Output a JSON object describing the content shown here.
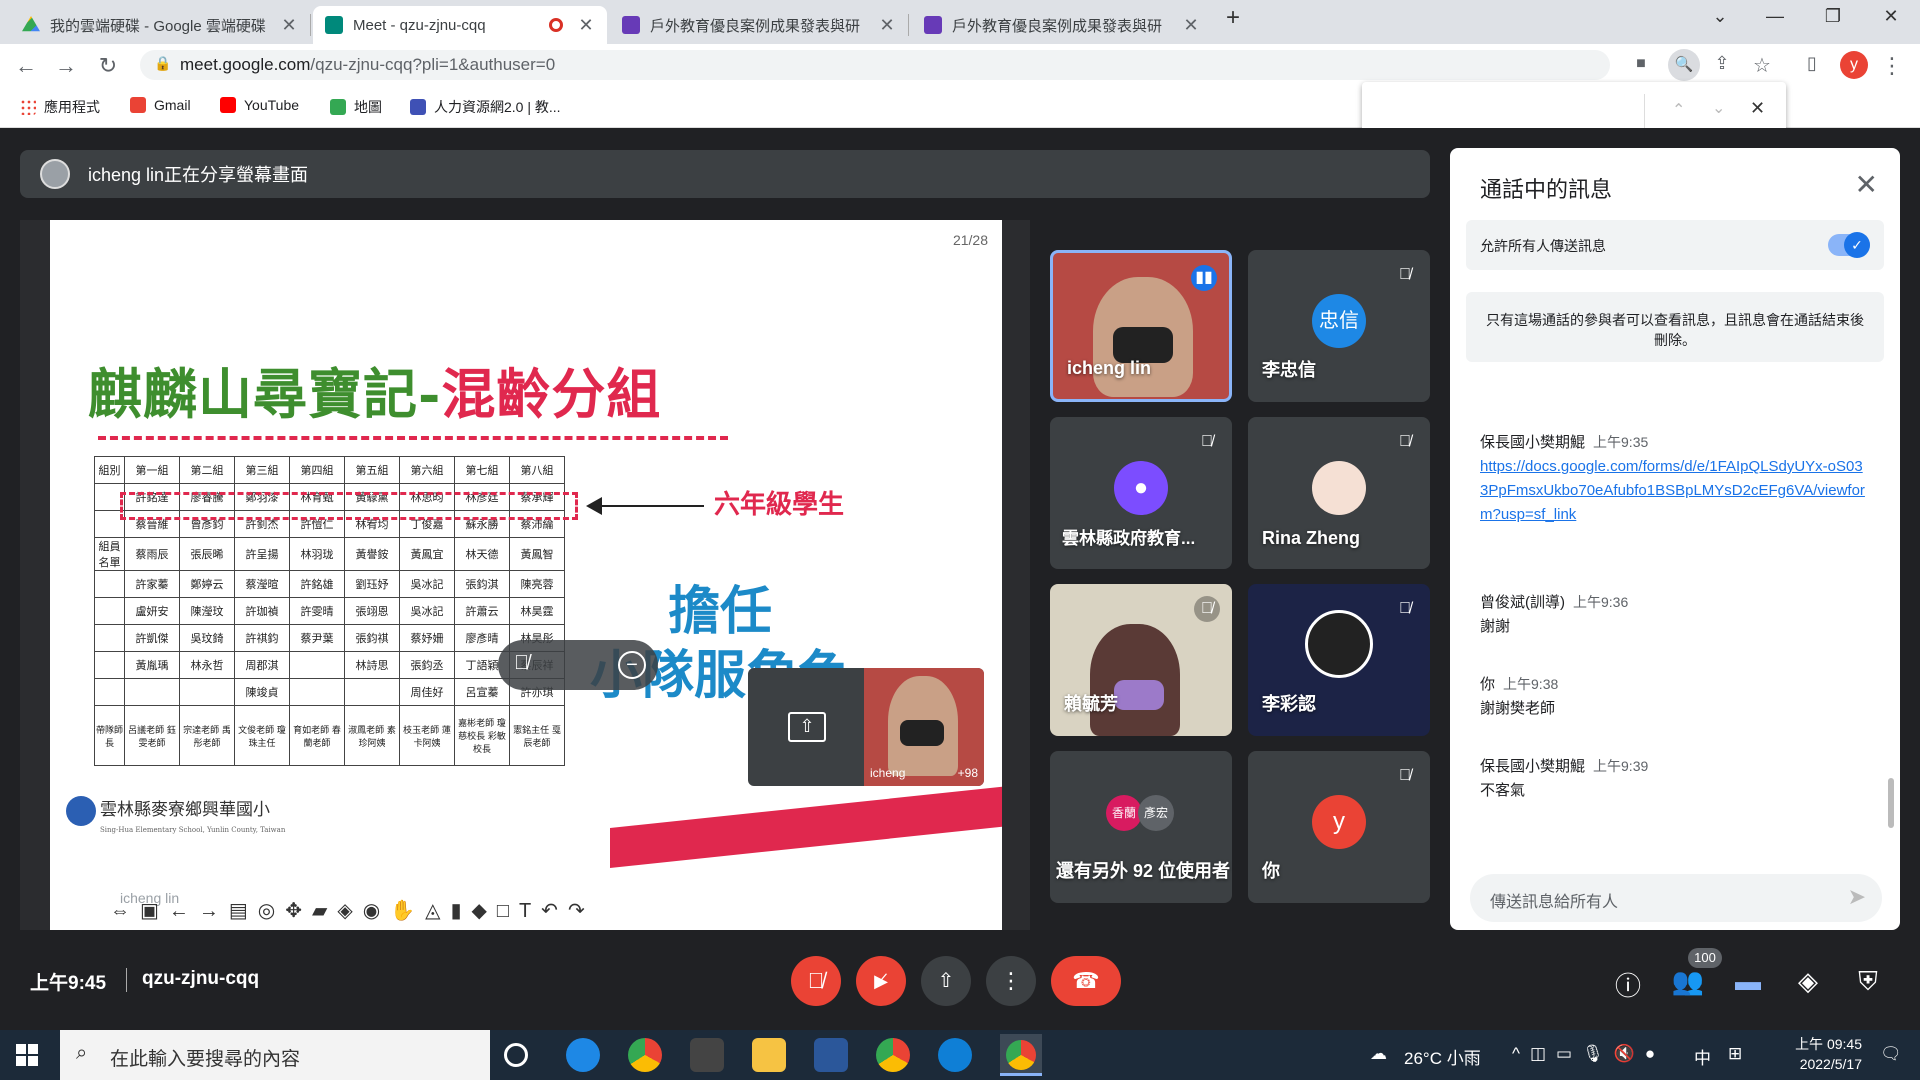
{
  "tabs": [
    {
      "title": "我的雲端硬碟 - Google 雲端硬碟",
      "color": "#1a73e8"
    },
    {
      "title": "Meet - qzu-zjnu-cqq",
      "color": "#00897b",
      "active": true
    },
    {
      "title": "戶外教育優良案例成果發表與研",
      "color": "#673ab7"
    },
    {
      "title": "戶外教育優良案例成果發表與研",
      "color": "#673ab7"
    }
  ],
  "url": {
    "host": "meet.google.com",
    "path": "/qzu-zjnu-cqq?pli=1&authuser=0"
  },
  "bookmarks": [
    "應用程式",
    "Gmail",
    "YouTube",
    "地圖",
    "人力資源網2.0 | 教..."
  ],
  "share_banner": "icheng lin正在分享螢幕畫面",
  "slide": {
    "page": "21/28",
    "title_main": "麒麟山尋寶記-",
    "title_accent": "混齡分組",
    "label_sixth": "六年級學生",
    "big_line1": "擔任",
    "big_line2": "小隊服角色",
    "school": "雲林縣麥寮鄉興華國小",
    "school_en": "Sing-Hua Elementary School, Yunlin County, Taiwan",
    "presenter_tag": "icheng lin",
    "table_header": [
      "組別",
      "第一組",
      "第二組",
      "第三組",
      "第四組",
      "第五組",
      "第六組",
      "第七組",
      "第八組"
    ],
    "table_rows": [
      [
        "",
        "許銘達",
        "廖睿騰",
        "鄭羽漆",
        "林育甄",
        "黃騄熏",
        "林思昀",
        "林彥廷",
        "蔡承輝"
      ],
      [
        "",
        "蔡晉維",
        "曾彥鈞",
        "許釗杰",
        "許愷仁",
        "林宥均",
        "丁俊嘉",
        "蘇永勝",
        "蔡沛綸"
      ],
      [
        "組員名單",
        "蔡雨辰",
        "張辰晞",
        "許呈揚",
        "林羽珑",
        "黃譽銨",
        "黃鳳宜",
        "林天德",
        "黃鳳智"
      ],
      [
        "",
        "許家蓁",
        "鄭婷云",
        "蔡瀅暄",
        "許銘雄",
        "劉珏妤",
        "吳冰記",
        "張鈞淇",
        "陳亮蓉"
      ],
      [
        "",
        "盧妍安",
        "陳瀅玟",
        "許珈禎",
        "許雯晴",
        "張翊恩",
        "吳冰記",
        "許蕭云",
        "林昊霆"
      ],
      [
        "",
        "許凱傑",
        "吳玟錡",
        "許祺鈞",
        "蔡尹葉",
        "張鈞祺",
        "蔡妤姍",
        "廖彥晴",
        "林昊彤"
      ],
      [
        "",
        "黃胤瑀",
        "林永哲",
        "周郡淇",
        "",
        "林詩思",
        "張鈞丞",
        "丁語穎",
        "蔡辰祥"
      ],
      [
        "",
        "",
        "",
        "陳竣貞",
        "",
        "",
        "周佳好",
        "呂宣蓁",
        "許亦琪"
      ],
      [
        "帶隊師長",
        "呂議老師 鈺雯老師",
        "宗達老師 禹彤老師",
        "文俊老師 瓊珠主任",
        "育如老師 春蘭老師",
        "淑鳳老師 素珍阿姨",
        "枝玉老師 蓮卡阿姨",
        "嘉彬老師 瓊慈校長 彩敏校長",
        "憲銘主任 戛辰老師"
      ]
    ],
    "pip_name": "icheng",
    "pip_count": "+98"
  },
  "participants": [
    {
      "name": "icheng lin",
      "type": "video",
      "speaking": true
    },
    {
      "name": "李忠信",
      "avatar": "忠信",
      "color": "#1e88e5"
    },
    {
      "name": "雲林縣政府教育...",
      "avatar": "",
      "color": "#7c4dff"
    },
    {
      "name": "Rina Zheng",
      "type": "photo"
    },
    {
      "name": "賴毓芳",
      "type": "video"
    },
    {
      "name": "李彩認",
      "type": "obs"
    },
    {
      "name": "還有另外 92 位使用者",
      "avatars": [
        "香蘭",
        "彥宏"
      ]
    },
    {
      "name": "你",
      "avatar": "y",
      "color": "#ea4335"
    }
  ],
  "chat": {
    "title": "通話中的訊息",
    "allow_label": "允許所有人傳送訊息",
    "info": "只有這場通話的參與者可以查看訊息，且訊息會在通話結束後刪除。",
    "messages": [
      {
        "sender": "保長國小樊期鯤",
        "time": "上午9:35",
        "text": "https://docs.google.com/forms/d/e/1FAIpQLSdyUYx-oS033PpFmsxUkbo70eAfubfo1BSBpLMYsD2cEFg6VA/viewform?usp=sf_link",
        "link": true
      },
      {
        "sender": "曾俊斌(訓導)",
        "time": "上午9:36",
        "text": "謝謝"
      },
      {
        "sender": "你",
        "time": "上午9:38",
        "text": "謝謝樊老師"
      },
      {
        "sender": "保長國小樊期鯤",
        "time": "上午9:39",
        "text": "不客氣"
      }
    ],
    "placeholder": "傳送訊息給所有人"
  },
  "bottom": {
    "time": "上午9:45",
    "code": "qzu-zjnu-cqq",
    "participants_badge": "100"
  },
  "taskbar": {
    "search": "在此輸入要搜尋的內容",
    "weather": "26°C 小雨",
    "ime": "中",
    "clock_time": "上午 09:45",
    "clock_date": "2022/5/17"
  }
}
